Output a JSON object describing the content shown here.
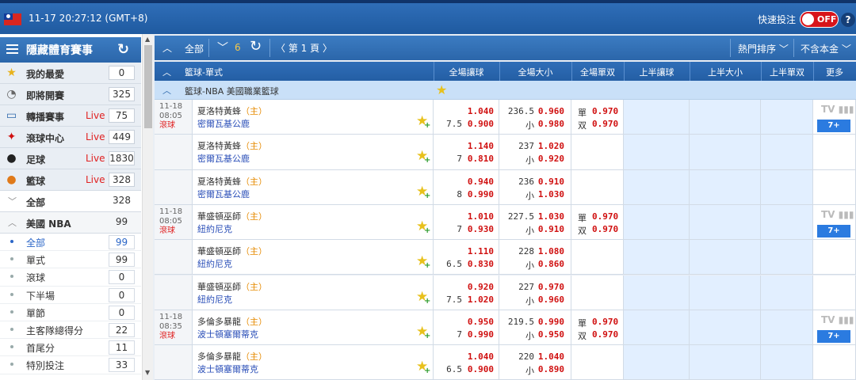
{
  "topbar": {
    "datetime": "11-17 20:27:12 (GMT+8)",
    "quick_bet_label": "快速投注",
    "toggle_state": "OFF",
    "help": "?"
  },
  "sidebar": {
    "title": "隱藏體育賽事",
    "items": [
      {
        "label": "我的最愛",
        "count": "0",
        "icon": "star-icon",
        "live": ""
      },
      {
        "label": "即將開賽",
        "count": "325",
        "icon": "stopwatch-icon",
        "live": ""
      },
      {
        "label": "轉播賽事",
        "count": "75",
        "icon": "tv-icon",
        "live": "Live"
      },
      {
        "label": "滾球中心",
        "count": "449",
        "icon": "runner-icon",
        "live": "Live"
      },
      {
        "label": "足球",
        "count": "1830",
        "icon": "soccer-icon",
        "live": "Live"
      },
      {
        "label": "籃球",
        "count": "328",
        "icon": "basketball-icon",
        "live": "Live"
      },
      {
        "label": "全部",
        "count": "328"
      },
      {
        "label": "美國 NBA",
        "count": "99"
      }
    ],
    "sub_items": [
      {
        "label": "全部",
        "count": "99"
      },
      {
        "label": "單式",
        "count": "99"
      },
      {
        "label": "滾球",
        "count": "0"
      },
      {
        "label": "下半場",
        "count": "0"
      },
      {
        "label": "單節",
        "count": "0"
      },
      {
        "label": "主客隊總得分",
        "count": "22"
      },
      {
        "label": "首尾分",
        "count": "11"
      },
      {
        "label": "特別投注",
        "count": "33"
      }
    ]
  },
  "toolbar": {
    "all": "全部",
    "count": "6",
    "page": "第 1 頁",
    "sort": "熱門排序",
    "currency": "不含本金"
  },
  "header": {
    "market": "籃球-單式",
    "cols": [
      "全場讓球",
      "全場大小",
      "全場單双",
      "上半讓球",
      "上半大小",
      "上半單双",
      "更多"
    ]
  },
  "league": {
    "name": "籃球-NBA 美國職業籃球"
  },
  "rows": [
    {
      "date": "11-18",
      "time": "08:05",
      "live": "滾球",
      "home": "夏洛特黃蜂",
      "home_tag": "（主）",
      "away": "密爾瓦基公鹿",
      "hdp_top": "1.040",
      "hdp_line": "7.5",
      "hdp_bot": "0.900",
      "ou_line": "236.5",
      "ou_top": "0.960",
      "ou_label": "小",
      "ou_bot": "0.980",
      "oe_top_label": "單",
      "oe_top": "0.970",
      "oe_bot_label": "双",
      "oe_bot": "0.970",
      "tv": "TV",
      "more": "7+"
    },
    {
      "home": "夏洛特黃蜂",
      "home_tag": "（主）",
      "away": "密爾瓦基公鹿",
      "hdp_top": "1.140",
      "hdp_line": "7",
      "hdp_bot": "0.810",
      "ou_line": "237",
      "ou_top": "1.020",
      "ou_label": "小",
      "ou_bot": "0.920"
    },
    {
      "home": "夏洛特黃蜂",
      "home_tag": "（主）",
      "away": "密爾瓦基公鹿",
      "hdp_top": "0.940",
      "hdp_line": "8",
      "hdp_bot": "0.990",
      "ou_line": "236",
      "ou_top": "0.910",
      "ou_label": "小",
      "ou_bot": "1.030"
    },
    {
      "date": "11-18",
      "time": "08:05",
      "live": "滾球",
      "home": "華盛頓巫師",
      "home_tag": "（主）",
      "away": "紐約尼克",
      "hdp_top": "1.010",
      "hdp_line": "7",
      "hdp_bot": "0.930",
      "ou_line": "227.5",
      "ou_top": "1.030",
      "ou_label": "小",
      "ou_bot": "0.910",
      "oe_top_label": "單",
      "oe_top": "0.970",
      "oe_bot_label": "双",
      "oe_bot": "0.970",
      "tv": "TV",
      "more": "7+"
    },
    {
      "home": "華盛頓巫師",
      "home_tag": "（主）",
      "away": "紐約尼克",
      "hdp_top": "1.110",
      "hdp_line": "6.5",
      "hdp_bot": "0.830",
      "ou_line": "228",
      "ou_top": "1.080",
      "ou_label": "小",
      "ou_bot": "0.860"
    },
    {
      "home": "華盛頓巫師",
      "home_tag": "（主）",
      "away": "紐約尼克",
      "hdp_top": "0.920",
      "hdp_line": "7.5",
      "hdp_bot": "1.020",
      "ou_line": "227",
      "ou_top": "0.970",
      "ou_label": "小",
      "ou_bot": "0.960"
    },
    {
      "date": "11-18",
      "time": "08:35",
      "live": "滾球",
      "home": "多倫多暴龍",
      "home_tag": "（主）",
      "away": "波士頓塞爾蒂克",
      "hdp_top": "0.950",
      "hdp_line": "7",
      "hdp_bot": "0.990",
      "ou_line": "219.5",
      "ou_top": "0.990",
      "ou_label": "小",
      "ou_bot": "0.950",
      "oe_top_label": "單",
      "oe_top": "0.970",
      "oe_bot_label": "双",
      "oe_bot": "0.970",
      "tv": "TV",
      "more": "7+"
    },
    {
      "home": "多倫多暴龍",
      "home_tag": "（主）",
      "away": "波士頓塞爾蒂克",
      "hdp_top": "1.040",
      "hdp_line": "6.5",
      "hdp_bot": "0.900",
      "ou_line": "220",
      "ou_top": "1.040",
      "ou_label": "小",
      "ou_bot": "0.890"
    }
  ]
}
